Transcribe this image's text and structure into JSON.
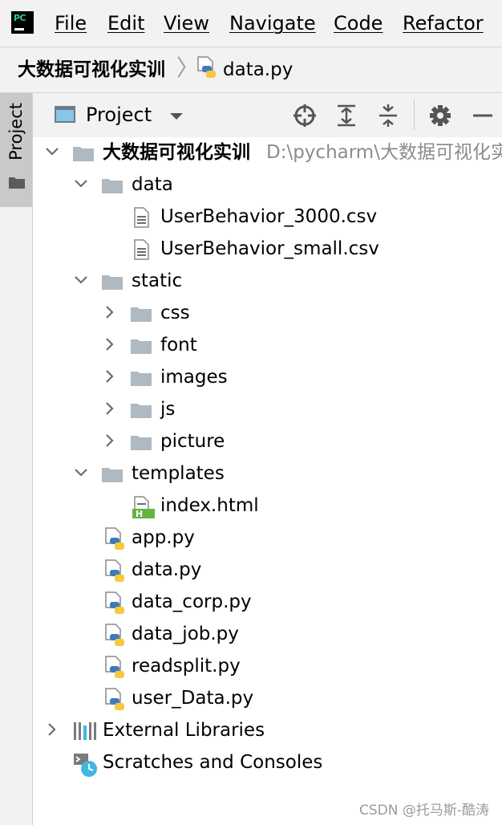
{
  "menubar": {
    "items": [
      "File",
      "Edit",
      "View",
      "Navigate",
      "Code",
      "Refactor"
    ]
  },
  "breadcrumb": {
    "project": "大数据可视化实训",
    "file": "data.py"
  },
  "sidebar": {
    "tab_label": "Project"
  },
  "toolwindow": {
    "title": "Project"
  },
  "tree": {
    "root": {
      "label": "大数据可视化实训",
      "path": "D:\\pycharm\\大数据可视化实"
    },
    "rows": [
      {
        "label": "data"
      },
      {
        "label": "UserBehavior_3000.csv"
      },
      {
        "label": "UserBehavior_small.csv"
      },
      {
        "label": "static"
      },
      {
        "label": "css"
      },
      {
        "label": "font"
      },
      {
        "label": "images"
      },
      {
        "label": "js"
      },
      {
        "label": "picture"
      },
      {
        "label": "templates"
      },
      {
        "label": "index.html"
      },
      {
        "label": "app.py"
      },
      {
        "label": "data.py"
      },
      {
        "label": "data_corp.py"
      },
      {
        "label": "data_job.py"
      },
      {
        "label": "readsplit.py"
      },
      {
        "label": "user_Data.py"
      },
      {
        "label": "External Libraries"
      },
      {
        "label": "Scratches and Consoles"
      }
    ]
  },
  "watermark": "CSDN @托马斯-酷涛",
  "colors": {
    "folder": "#aeb9c2",
    "python_blue": "#3d7ab8",
    "python_yellow": "#f7c93e",
    "html_green": "#62b543",
    "accent_logo": "#21d789"
  }
}
